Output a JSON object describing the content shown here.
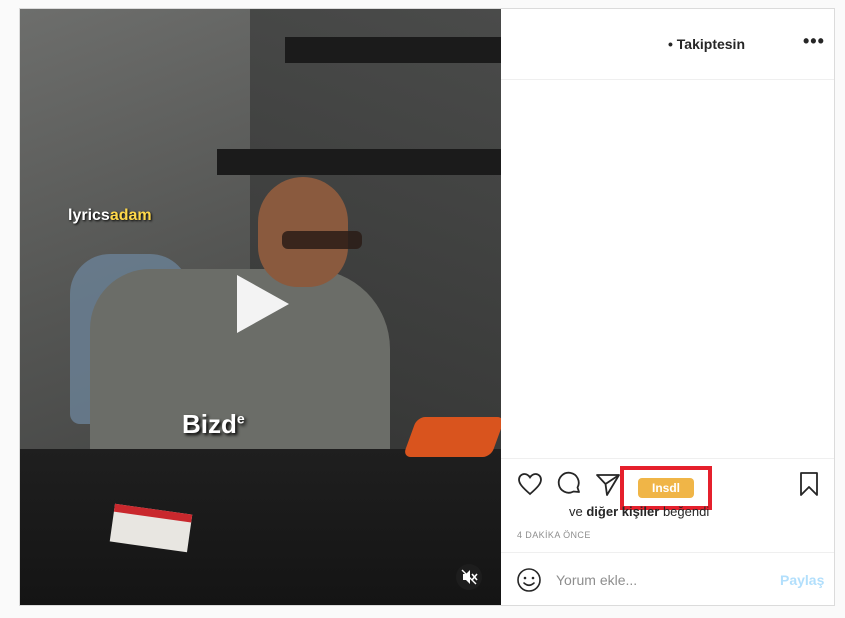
{
  "header": {
    "follow_status": "• Takiptesin",
    "more_label": "•••"
  },
  "media": {
    "watermark_a": "lyrics",
    "watermark_b": "adam",
    "caption": "Bizd",
    "caption_sup": "e"
  },
  "actions": {
    "badge": "Insdl",
    "likes_prefix": "ve ",
    "likes_bold": "diğer kişiler",
    "likes_suffix": " beğendi",
    "timestamp": "4 DAKİKA ÖNCE"
  },
  "comment": {
    "placeholder": "Yorum ekle...",
    "share": "Paylaş"
  },
  "colors": {
    "badge": "#f0b547",
    "highlight_box": "#e5202c",
    "share": "#b2dffc"
  },
  "icons": [
    "heart-icon",
    "comment-icon",
    "share-icon",
    "bookmark-icon",
    "emoji-icon",
    "play-icon",
    "mute-icon",
    "more-icon"
  ]
}
